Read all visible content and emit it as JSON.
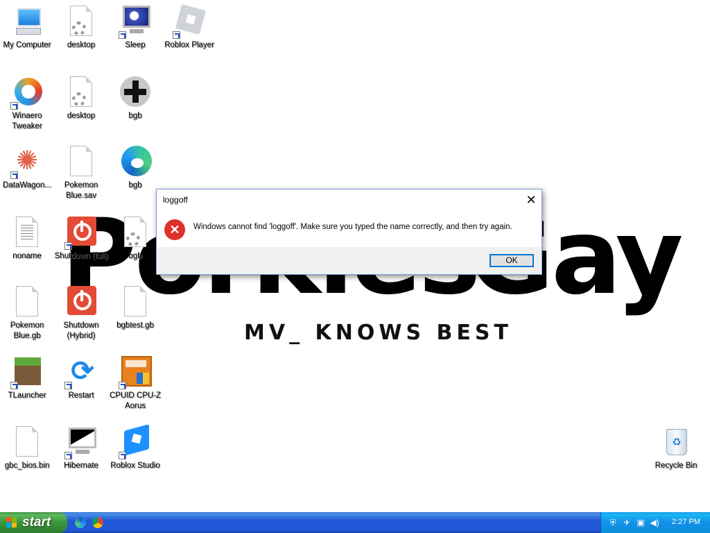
{
  "wallpaper": {
    "headline_left": "Porkies",
    "headline_dash": "–",
    "headline_right": "Gay",
    "subtitle": "MV_ KNOWS BEST"
  },
  "desktop_icons": [
    {
      "label": "My Computer",
      "icon": "computer-icon"
    },
    {
      "label": "desktop",
      "icon": "settings-file-icon"
    },
    {
      "label": "Sleep",
      "icon": "monitor-icon"
    },
    {
      "label": "Roblox Player",
      "icon": "roblox-icon"
    },
    {
      "label": "Winaero Tweaker",
      "icon": "winaero-icon"
    },
    {
      "label": "desktop",
      "icon": "settings-file-icon"
    },
    {
      "label": "bgb",
      "icon": "gamepad-icon"
    },
    {
      "label": "DataWagon...",
      "icon": "datawagon-icon"
    },
    {
      "label": "Pokemon Blue.sav",
      "icon": "file-icon"
    },
    {
      "label": "bgb",
      "icon": "edge-icon"
    },
    {
      "label": "noname",
      "icon": "text-file-icon"
    },
    {
      "label": "Shutdown (full)",
      "icon": "power-icon"
    },
    {
      "label": "bgb",
      "icon": "settings-file-icon"
    },
    {
      "label": "Pokemon Blue.gb",
      "icon": "file-icon"
    },
    {
      "label": "Shutdown (Hybrid)",
      "icon": "power-icon"
    },
    {
      "label": "bgbtest.gb",
      "icon": "file-icon"
    },
    {
      "label": "TLauncher",
      "icon": "minecraft-icon"
    },
    {
      "label": "Restart",
      "icon": "restart-icon"
    },
    {
      "label": "CPUID CPU-Z Aorus",
      "icon": "cpuz-icon"
    },
    {
      "label": "gbc_bios.bin",
      "icon": "file-icon"
    },
    {
      "label": "Hibernate",
      "icon": "monitor-icon"
    },
    {
      "label": "Roblox Studio",
      "icon": "roblox-studio-icon"
    },
    {
      "label": "Recycle Bin",
      "icon": "recycle-bin-icon"
    }
  ],
  "dialog": {
    "title": "loggoff",
    "close_glyph": "✕",
    "message": "Windows cannot find 'loggoff'. Make sure you typed the name correctly, and then try again.",
    "ok_label": "OK"
  },
  "taskbar": {
    "start_label": "start",
    "quick_launch": [
      "edge-icon",
      "chrome-icon"
    ],
    "clock": "2:27 PM",
    "tray_icons": [
      "shield-icon",
      "network-disabled-icon",
      "network-icon",
      "volume-icon"
    ]
  }
}
